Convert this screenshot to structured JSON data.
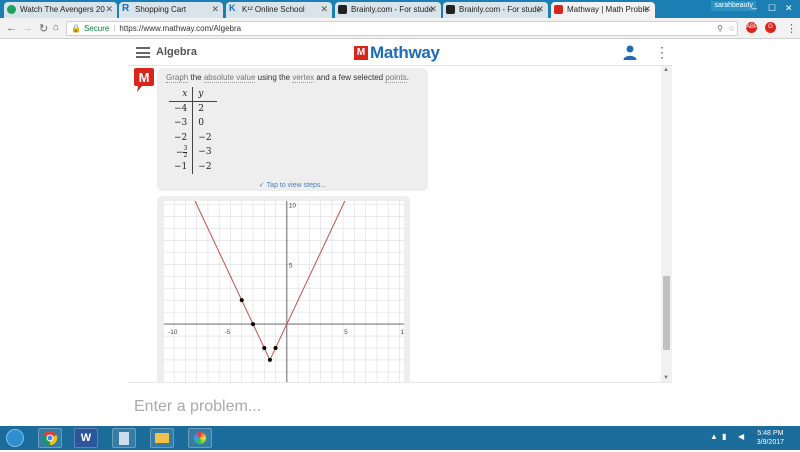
{
  "browser": {
    "tabs": [
      {
        "label": "Watch The Avengers 20",
        "icon": "play-icon",
        "color": "#1aa260"
      },
      {
        "label": "Shopping Cart",
        "icon": "r-icon",
        "color": "#3b5998"
      },
      {
        "label": "K¹² Online School",
        "icon": "k12-icon",
        "color": "#1e6bb8"
      },
      {
        "label": "Brainly.com - For stude",
        "icon": "brainly-icon",
        "color": "#222222"
      },
      {
        "label": "Brainly.com - For stude",
        "icon": "brainly-icon",
        "color": "#222222"
      },
      {
        "label": "Mathway | Math Proble",
        "icon": "mathway-icon",
        "color": "#d9261c"
      }
    ],
    "window_user": "sarahbeauty",
    "url_secure_label": "Secure",
    "url": "https://www.mathway.com/Algebra"
  },
  "app": {
    "section_title": "Algebra",
    "logo_letter": "M",
    "logo_text": "Mathway",
    "brand_color": "#1e6bb8",
    "logo_red": "#d9261c"
  },
  "question": {
    "word_graph": "Graph",
    "text_the": "the",
    "word_abs": "absolute value",
    "text_using": "using the",
    "word_vertex": "vertex",
    "text_and": "and a few selected",
    "word_points": "points",
    "text_end": "."
  },
  "table": {
    "header_x": "x",
    "header_y": "y",
    "rows": [
      {
        "x": "−4",
        "y": "2"
      },
      {
        "x": "−3",
        "y": "0"
      },
      {
        "x": "−2",
        "y": "−2"
      },
      {
        "x_sign": "−",
        "x_num": "3",
        "x_den": "2",
        "y": "−3"
      },
      {
        "x": "−1",
        "y": "−2"
      }
    ]
  },
  "steps_label": "Tap to view steps...",
  "chart_data": {
    "type": "line",
    "function": "y = 2|x + 1.5| - 3",
    "xlim": [
      -10,
      10
    ],
    "ylim": [
      -5,
      10
    ],
    "grid": true,
    "xticks": [
      -10,
      -5,
      5,
      10
    ],
    "yticks": [
      10,
      5,
      -5
    ],
    "xtick_labels": [
      "-10",
      "-5",
      "5",
      "10"
    ],
    "ytick_labels": [
      "10",
      "5",
      "-5"
    ],
    "series": [
      {
        "x": [
          -9.5,
          -1.5,
          6.5
        ],
        "y": [
          13,
          -3,
          13
        ],
        "color": "#c0504d"
      }
    ],
    "points": [
      {
        "x": -4,
        "y": 2
      },
      {
        "x": -3,
        "y": 0
      },
      {
        "x": -2,
        "y": -2
      },
      {
        "x": -1.5,
        "y": -3
      },
      {
        "x": -1,
        "y": -2
      }
    ]
  },
  "input_placeholder": "Enter a problem...",
  "taskbar": {
    "apps": [
      {
        "name": "chrome",
        "label": ""
      },
      {
        "name": "word",
        "label": "W"
      },
      {
        "name": "notepad",
        "label": ""
      },
      {
        "name": "explorer",
        "label": ""
      },
      {
        "name": "paint",
        "label": ""
      }
    ],
    "time": "5:48 PM",
    "date": "3/9/2017"
  }
}
